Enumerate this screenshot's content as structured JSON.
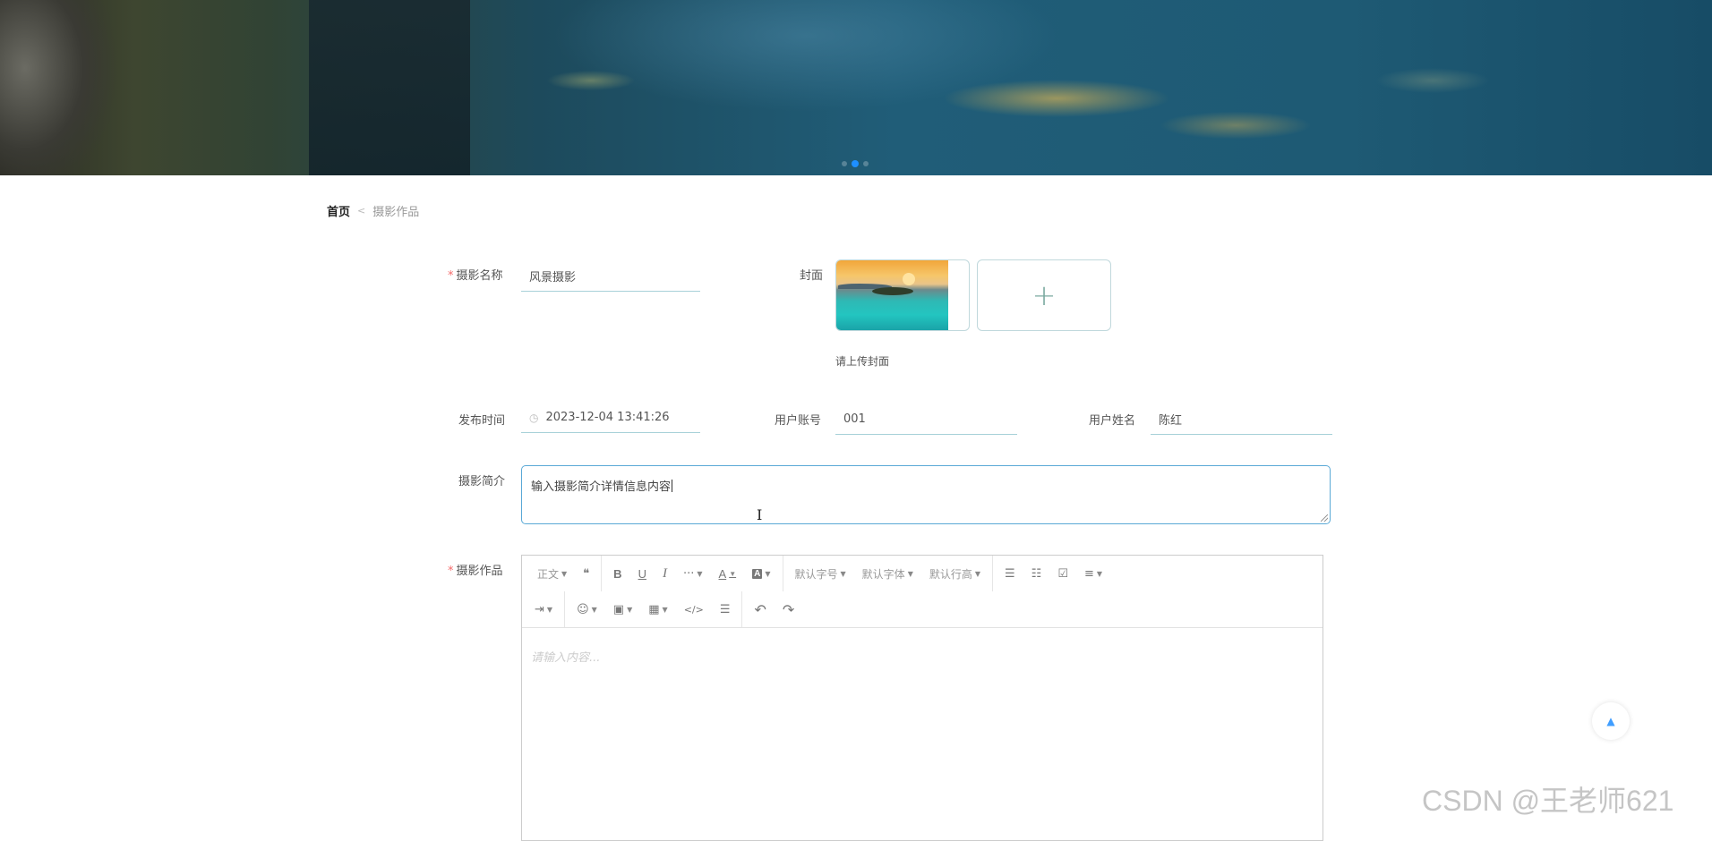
{
  "banner": {
    "slides": 3,
    "active_slide": 2
  },
  "breadcrumb": {
    "home": "首页",
    "separator": "<",
    "current": "摄影作品"
  },
  "form": {
    "title_label": "摄影名称",
    "title_value": "风景摄影",
    "cover_label": "封面",
    "cover_upload_symbol": "+",
    "cover_tip": "请上传封面",
    "publish_time_label": "发布时间",
    "publish_time_value": "2023-12-04 13:41:26",
    "account_label": "用户账号",
    "account_value": "001",
    "username_label": "用户姓名",
    "username_value": "陈红",
    "intro_label": "摄影简介",
    "intro_value": "输入摄影简介详情信息内容",
    "works_label": "摄影作品",
    "required_mark": "*"
  },
  "editor": {
    "toolbar_row1": {
      "paragraph": "正文",
      "quote": "❝",
      "bold": "B",
      "underline": "U",
      "italic": "I",
      "more": "···",
      "font_color": "A",
      "bg_color": "A",
      "font_size": "默认字号",
      "font_family": "默认字体",
      "line_height": "默认行高",
      "bulleted_list": "☰",
      "numbered_list": "☷",
      "todo": "☑",
      "align": "≡"
    },
    "toolbar_row2": {
      "indent": "⇥",
      "emoji": "☺",
      "image": "▣",
      "table": "▦",
      "code": "</>",
      "divider": "☰",
      "undo": "↶",
      "redo": "↷"
    },
    "placeholder": "请输入内容..."
  },
  "back_to_top": "▲",
  "watermark": "CSDN @王老师621",
  "colors": {
    "accent": "#1e8fff",
    "required": "#f56c6c",
    "input_border": "#a7d1d8",
    "focus_border": "#5aa9d6"
  }
}
